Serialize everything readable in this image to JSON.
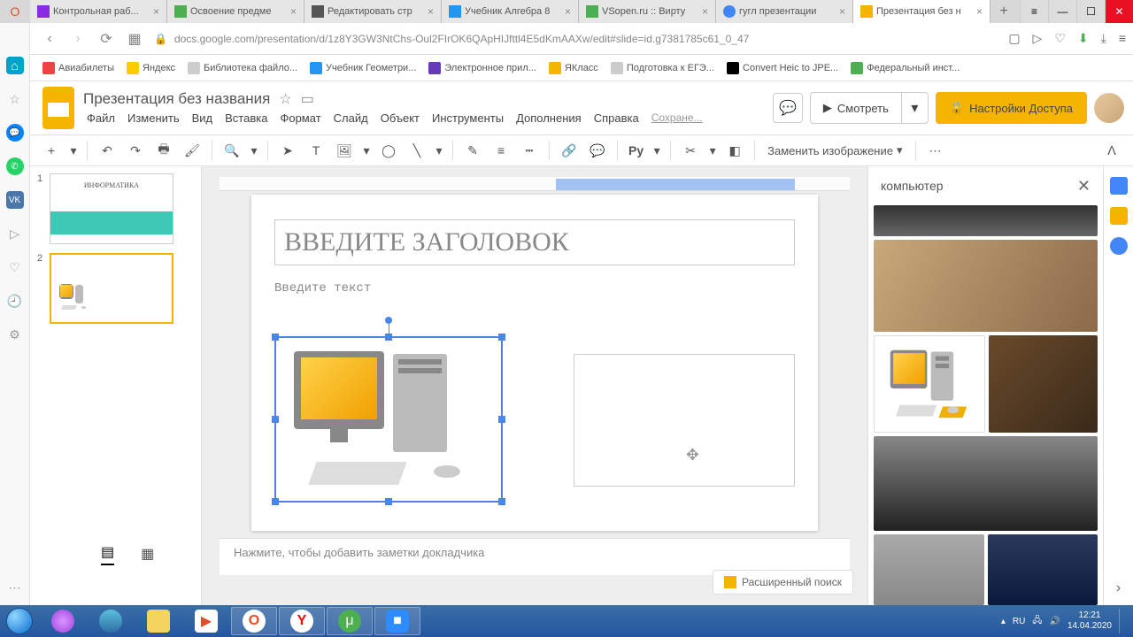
{
  "browser": {
    "tabs": [
      {
        "title": "Контрольная раб...",
        "icon": "#8a2be2"
      },
      {
        "title": "Освоение предме",
        "icon": "#4caf50"
      },
      {
        "title": "Редактировать стр",
        "icon": "#555"
      },
      {
        "title": "Учебник Алгебра 8",
        "icon": "#2196f3"
      },
      {
        "title": "VSopen.ru :: Вирту",
        "icon": "#4caf50"
      },
      {
        "title": "гугл презентации",
        "icon": "#4285f4"
      },
      {
        "title": "Презентация без н",
        "icon": "#f4b400"
      }
    ],
    "url": "docs.google.com/presentation/d/1z8Y3GW3NtChs-Oul2FIrOK6QApHIJfttl4E5dKmAAXw/edit#slide=id.g7381785c61_0_47",
    "bookmarks": [
      "Авиабилеты",
      "Яндекс",
      "Библиотека файло...",
      "Учебник Геометри...",
      "Электронное прил...",
      "ЯКласс",
      "Подготовка к ЕГЭ...",
      "Convert Heic to JPE...",
      "Федеральный инст..."
    ]
  },
  "slides": {
    "docTitle": "Презентация без названия",
    "menu": [
      "Файл",
      "Изменить",
      "Вид",
      "Вставка",
      "Формат",
      "Слайд",
      "Объект",
      "Инструменты",
      "Дополнения",
      "Справка"
    ],
    "saving": "Сохране...",
    "presentLabel": "Смотреть",
    "shareLabel": "Настройки Доступа",
    "replaceImage": "Заменить изображение",
    "slide": {
      "titlePlaceholder": "Введите заголовок",
      "bodyPlaceholder": "Введите текст"
    },
    "thumb1Title": "Информатика",
    "speakerNotes": "Нажмите, чтобы добавить заметки докладчика",
    "advSearch": "Расширенный поиск",
    "searchTerm": "компьютер"
  },
  "systray": {
    "lang": "RU",
    "time": "12:21",
    "date": "14.04.2020"
  }
}
